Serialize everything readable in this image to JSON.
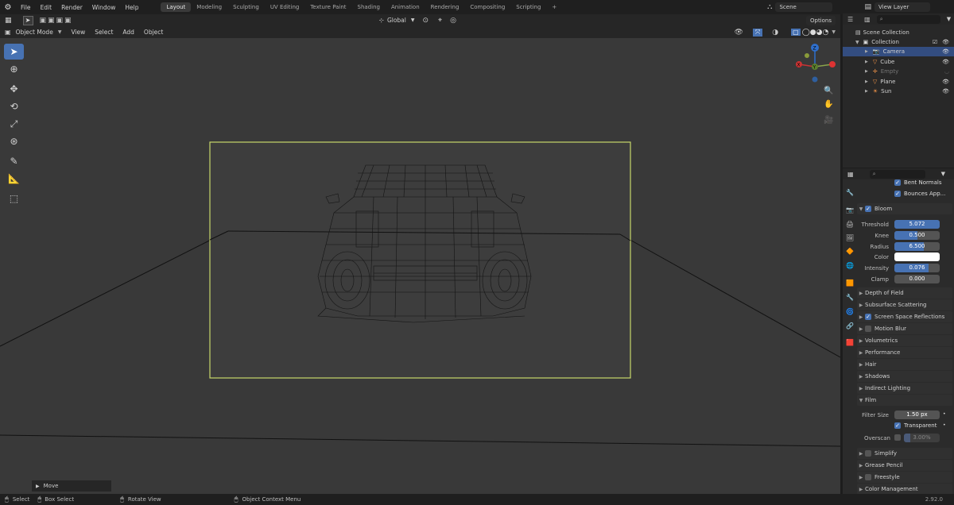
{
  "menu": [
    "File",
    "Edit",
    "Render",
    "Window",
    "Help"
  ],
  "workspaces": [
    "Layout",
    "Modeling",
    "Sculpting",
    "UV Editing",
    "Texture Paint",
    "Shading",
    "Animation",
    "Rendering",
    "Compositing",
    "Scripting"
  ],
  "active_workspace": "Layout",
  "add_tab": "+",
  "scene": "Scene",
  "view_layer": "View Layer",
  "viewport_header": {
    "mode": "Object Mode",
    "menus": [
      "View",
      "Select",
      "Add",
      "Object"
    ],
    "orientation": "Global",
    "options": "Options"
  },
  "navigation_gizmo": {
    "z": "Z",
    "y": "Y",
    "x": "X"
  },
  "outliner": {
    "root": "Scene Collection",
    "collection": "Collection",
    "items": [
      {
        "name": "Camera",
        "color": "#ff9b4a",
        "selected": true,
        "visible": true
      },
      {
        "name": "Cube",
        "color": "#ff9b4a",
        "selected": false,
        "visible": true
      },
      {
        "name": "Empty",
        "color": "#ff9b4a",
        "selected": false,
        "visible": false
      },
      {
        "name": "Plane",
        "color": "#ff9b4a",
        "selected": false,
        "visible": true
      },
      {
        "name": "Sun",
        "color": "#ff9b4a",
        "selected": false,
        "visible": true
      }
    ]
  },
  "properties": {
    "top_checks": [
      "Bent Normals",
      "Bounces App..."
    ],
    "bloom": {
      "label": "Bloom",
      "fields": [
        {
          "label": "Threshold",
          "value": "5.072",
          "fill": 1.0
        },
        {
          "label": "Knee",
          "value": "0.500",
          "fill": 0.5
        },
        {
          "label": "Radius",
          "value": "6.500",
          "fill": 0.65
        },
        {
          "label": "Color",
          "value": "",
          "fill": 0
        },
        {
          "label": "Intensity",
          "value": "0.076",
          "fill": 0.76
        },
        {
          "label": "Clamp",
          "value": "0.000",
          "fill": 0
        }
      ]
    },
    "panels": [
      {
        "label": "Depth of Field",
        "check": null,
        "open": false
      },
      {
        "label": "Subsurface Scattering",
        "check": null,
        "open": false
      },
      {
        "label": "Screen Space Reflections",
        "check": true,
        "open": false
      },
      {
        "label": "Motion Blur",
        "check": false,
        "open": false
      },
      {
        "label": "Volumetrics",
        "check": null,
        "open": false
      },
      {
        "label": "Performance",
        "check": null,
        "open": false
      },
      {
        "label": "Hair",
        "check": null,
        "open": false
      },
      {
        "label": "Shadows",
        "check": null,
        "open": false
      },
      {
        "label": "Indirect Lighting",
        "check": null,
        "open": false
      },
      {
        "label": "Film",
        "check": null,
        "open": true
      }
    ],
    "film": {
      "filter_size_label": "Filter Size",
      "filter_size": "1.50 px",
      "transparent": "Transparent",
      "overscan_label": "Overscan",
      "overscan": "3.00%"
    },
    "panels_after": [
      {
        "label": "Simplify",
        "check": false
      },
      {
        "label": "Grease Pencil",
        "check": null
      },
      {
        "label": "Freestyle",
        "check": false
      },
      {
        "label": "Color Management",
        "check": null
      }
    ]
  },
  "last_operator": "Move",
  "status": {
    "select": "Select",
    "box_select": "Box Select",
    "rotate": "Rotate View",
    "context": "Object Context Menu",
    "version": "2.92.0"
  }
}
